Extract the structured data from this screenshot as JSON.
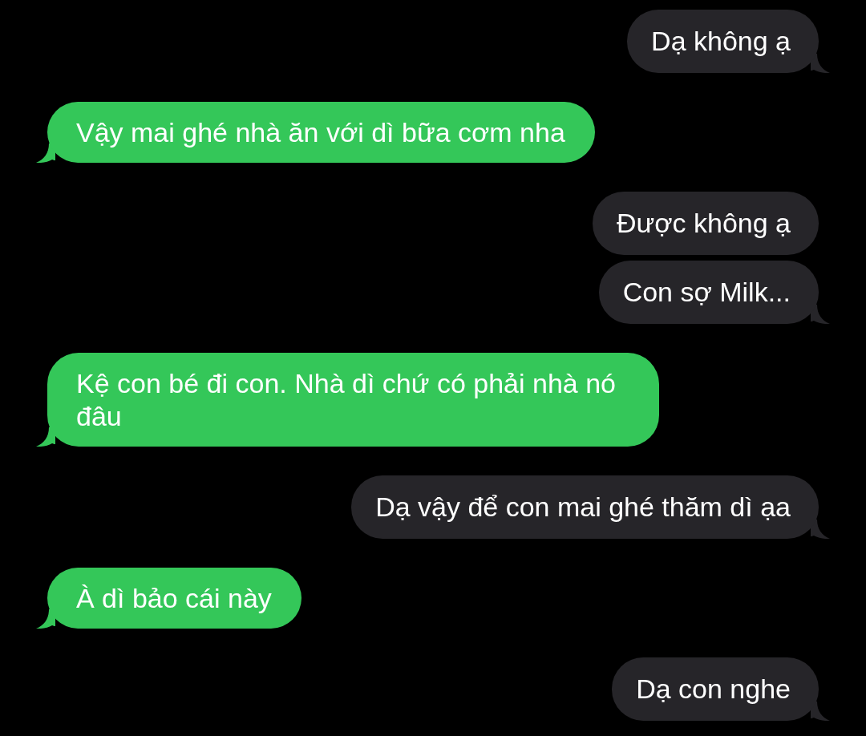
{
  "messages": [
    {
      "kind": "sent",
      "text": "Dạ không ạ",
      "tail": true
    },
    {
      "kind": "received",
      "text": "Vậy mai ghé nhà ăn với dì bữa cơm nha",
      "tail": true
    },
    {
      "kind": "sent",
      "text": "Được không ạ",
      "tail": false
    },
    {
      "kind": "sent",
      "text": "Con sợ Milk...",
      "tail": true
    },
    {
      "kind": "received",
      "text": "Kệ con bé đi con. Nhà dì chứ có phải nhà nó đâu",
      "tail": true
    },
    {
      "kind": "sent",
      "text": "Dạ vậy để con mai ghé thăm dì ạa",
      "tail": true
    },
    {
      "kind": "received",
      "text": "À dì bảo cái này",
      "tail": true
    },
    {
      "kind": "sent",
      "text": "Dạ con nghe",
      "tail": true
    }
  ]
}
